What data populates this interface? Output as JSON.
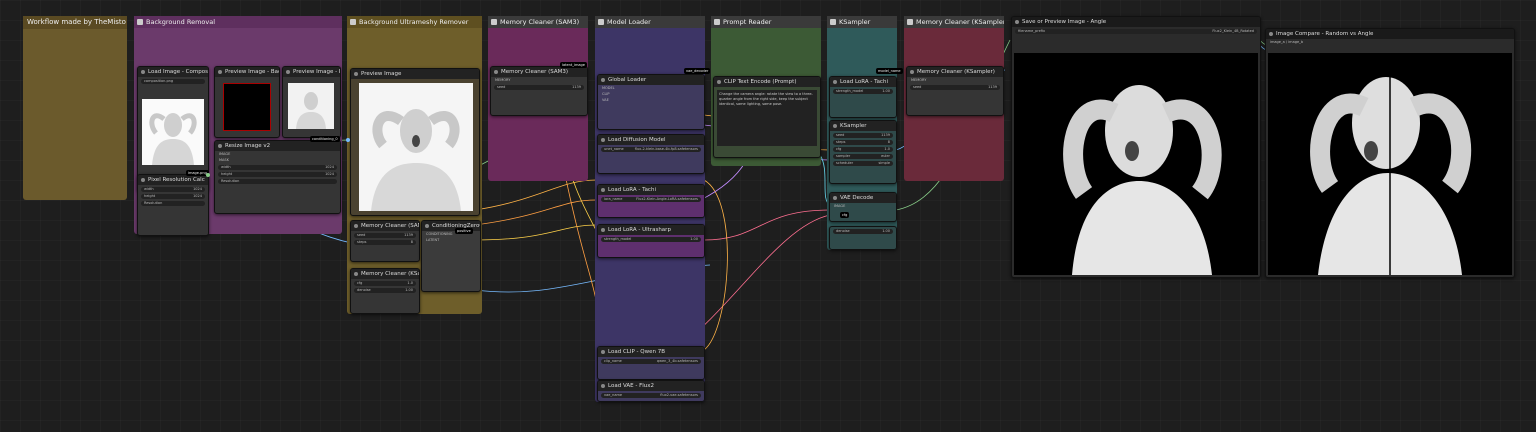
{
  "groups": {
    "workflow_notes": "Workflow made by TheMisto",
    "image_load": "Background Removal",
    "bg_remover": "Background Ultrameshy Remover",
    "memory_sam": "Memory Cleaner (SAM3)",
    "model_loader": "Model Loader",
    "prompt_reader": "Prompt Reader",
    "ksampler": "KSampler",
    "memory_ksampler": "Memory Cleaner (KSampler)"
  },
  "nodes": {
    "load_image": "Load Image - Composition",
    "preview_bg": "Preview Image - Background",
    "preview_rembg": "Preview Image - Rembg",
    "preview_image": "Preview Image",
    "resize": "Resize Image v2",
    "pixel_perfect": "Pixel Resolution Calc",
    "memory_sam_node": "Memory Cleaner (SAM3)",
    "sampler_custom": "Memory Cleaner (KSampler)",
    "global_loader": "Global Loader",
    "lora_1": "Load LoRA - Tachi",
    "lora_2": "Load LoRA - Ultrasharp",
    "diffusion": "Load Diffusion Model",
    "clip": "Load CLIP - Qwen 7B",
    "vae": "Load VAE - Flux2",
    "text_encode": "CLIP Text Encode (Prompt)",
    "conditioning": "ConditioningZeroOut",
    "ksampler_node": "KSampler",
    "vae_decode": "VAE Decode",
    "save_image": "Save or Preview Image - Angle",
    "compare": "Image Compare - Random vs Angle"
  },
  "badges": {
    "b1": "conditioning_0 ",
    "b2": "latent_image",
    "b3": "vae_decoder",
    "b4": "model_name",
    "b5": "image.png",
    "b6": "cfg",
    "b7": "positive"
  },
  "widgets": {
    "image_file": "composition.png",
    "resolution_label": "Resolution",
    "width_label": "width",
    "width_val": "1024",
    "height_label": "height",
    "height_val": "1024",
    "seed_label": "seed",
    "seed_val": "1139",
    "steps_label": "steps",
    "steps_val": "8",
    "cfg_label": "cfg",
    "cfg_val": "1.0",
    "sampler_label": "sampler",
    "sampler_val": "euler",
    "scheduler_label": "scheduler",
    "scheduler_val": "simple",
    "denoise_label": "denoise",
    "denoise_val": "1.00",
    "unet_label": "unet_name",
    "unet_val": "flux-2-klein-base-4b-fp8.safetensors",
    "clip_label": "clip_name",
    "clip_val": "qwen_3_4b.safetensors",
    "vae_label": "vae_name",
    "vae_val": "flux2-vae.safetensors",
    "prompt_text": "Change the camera angle: rotate the view to a three-quarter angle from the right side, keep the subject identical, same lighting, same pose.",
    "lora_label": "lora_name",
    "lora_val": "Flux2-Klein-Angle-LoRA.safetensors",
    "strength_label": "strength_model",
    "strength_val": "1.00",
    "filename_label": "filename_prefix",
    "filename_val": "Flux2_Klein_4B_Rotated"
  },
  "labels": {
    "memory_label": "MEMORY",
    "image_out": "IMAGE",
    "mask_out": "MASK",
    "model_out": "MODEL",
    "clip_out": "CLIP",
    "vae_out": "VAE",
    "latent_out": "LATENT",
    "cond_out": "CONDITIONING"
  },
  "compare": {
    "caption": "image_a / image_b"
  }
}
